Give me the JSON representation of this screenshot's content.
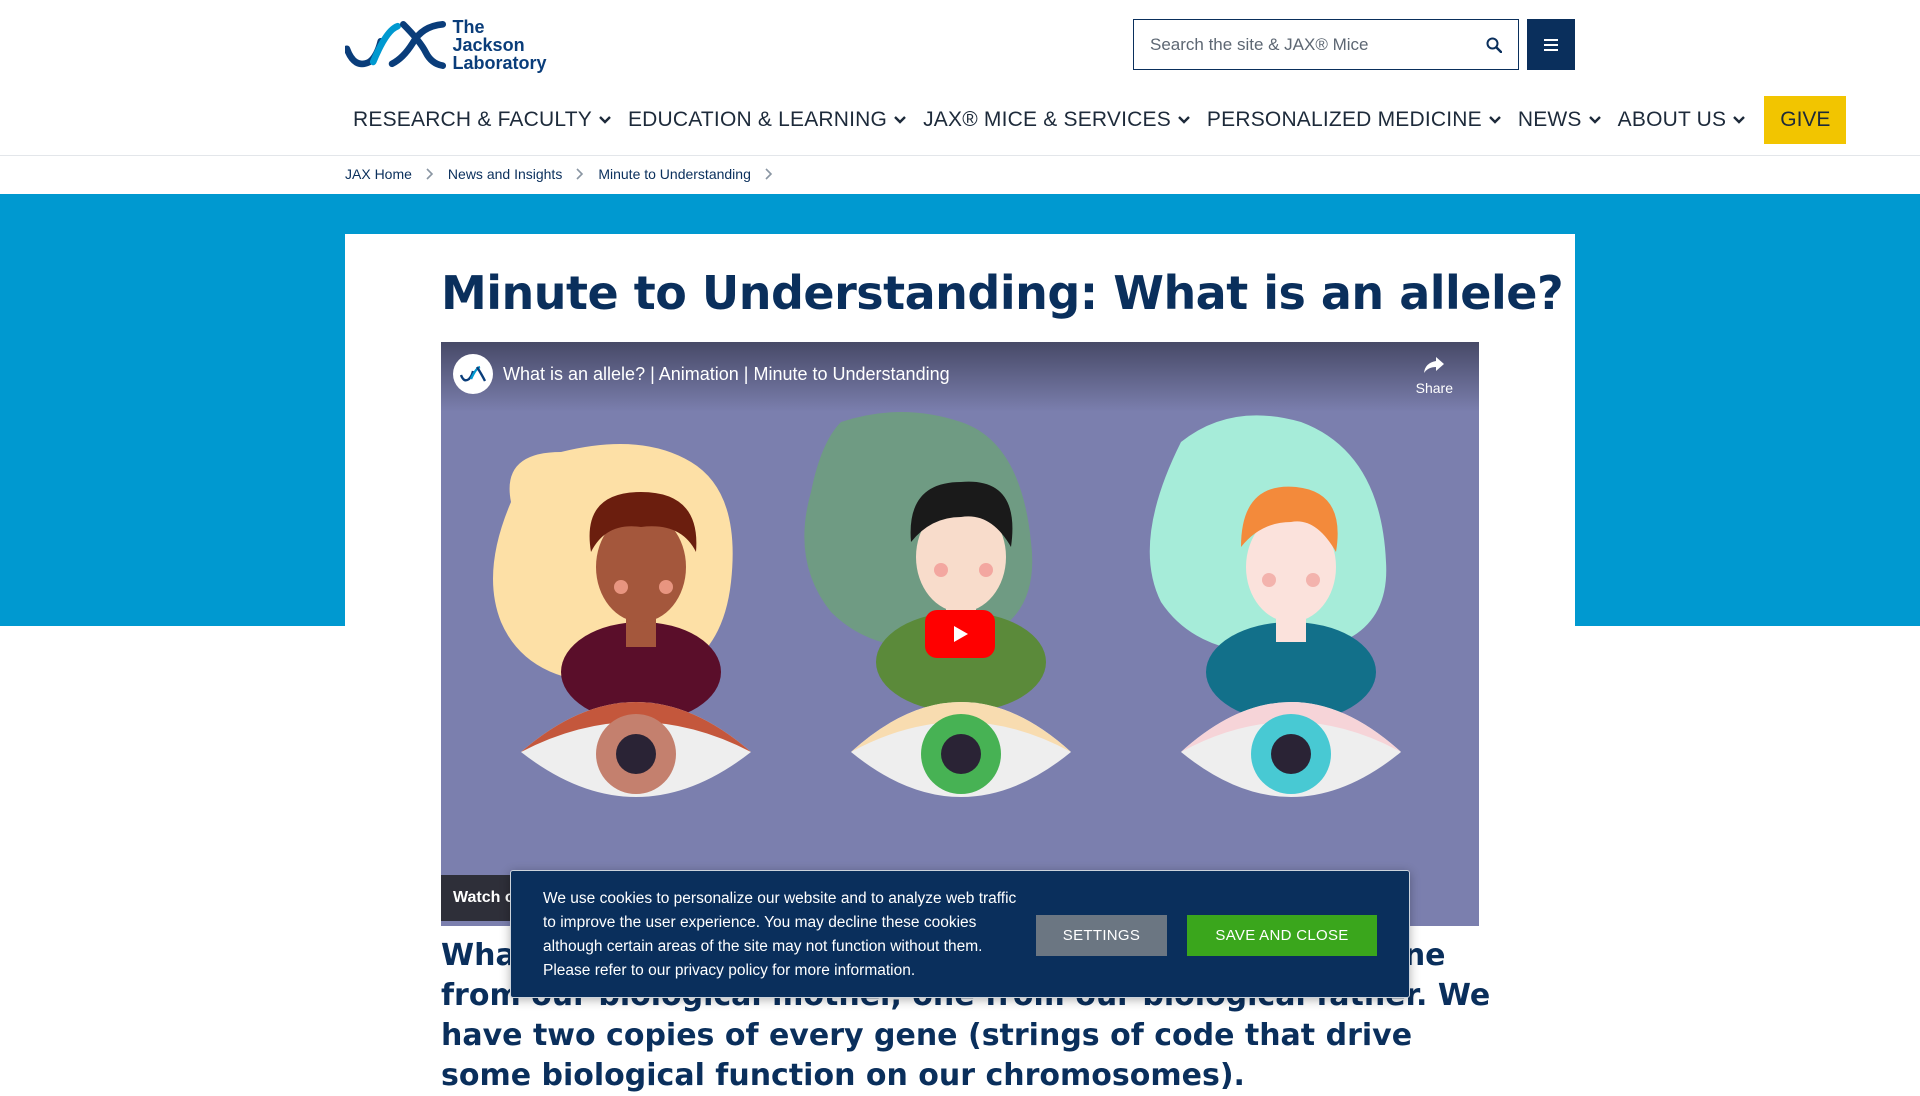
{
  "header": {
    "logo_line1": "The Jackson",
    "logo_line2": "Laboratory",
    "search_placeholder": "Search the site & JAX® Mice",
    "nav": [
      {
        "label": "RESEARCH & FACULTY"
      },
      {
        "label": "EDUCATION & LEARNING"
      },
      {
        "label": "JAX® MICE & SERVICES"
      },
      {
        "label": "PERSONALIZED MEDICINE"
      },
      {
        "label": "NEWS"
      },
      {
        "label": "ABOUT US"
      }
    ],
    "give_label": "GIVE"
  },
  "breadcrumbs": [
    {
      "label": "JAX Home"
    },
    {
      "label": "News and Insights"
    },
    {
      "label": "Minute to Understanding"
    }
  ],
  "colors": {
    "brand_navy": "#0a2f5c",
    "band_blue": "#0099d0",
    "give_yellow": "#f2c500",
    "save_green": "#3aa61c"
  },
  "main": {
    "title": "Minute to Understanding: What is an allele?",
    "video": {
      "title": "What is an allele? | Animation | Minute to Understanding",
      "share_label": "Share",
      "watch_label": "Watch o"
    },
    "body_text": "What is an allele? We all have two copies of our genes, one from our biological mother, one from our biological father. We have two copies of every gene (strings of code that drive some biological function on our chromosomes)."
  },
  "cookie_banner": {
    "text": "We use cookies to personalize our website and to analyze web traffic to improve the user experience. You may decline these cookies although certain areas of the site may not function without them. Please refer to our privacy policy for more information.",
    "settings_label": "SETTINGS",
    "save_label": "SAVE AND CLOSE"
  }
}
